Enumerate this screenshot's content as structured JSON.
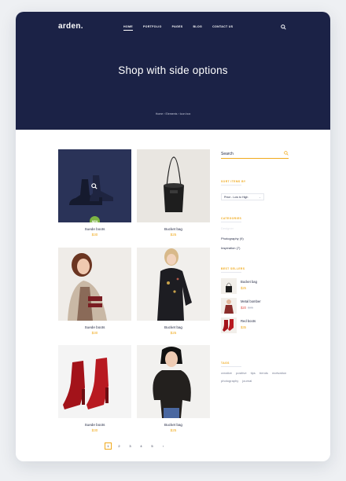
{
  "header": {
    "logo": "arden.",
    "nav": [
      "HOME",
      "PORTFOLIO",
      "PAGES",
      "BLOG",
      "CONTACT US"
    ],
    "active_nav": "HOME",
    "title": "Shop with side options",
    "breadcrumb": "Home › Elements › Icon box"
  },
  "products": [
    {
      "name": "Suede boots",
      "price": "$30",
      "badge": "NEW"
    },
    {
      "name": "Bucket bag",
      "price": "$25"
    },
    {
      "name": "Suede boots",
      "price": "$30"
    },
    {
      "name": "Bucket bag",
      "price": "$25"
    },
    {
      "name": "Suede boots",
      "price": "$30"
    },
    {
      "name": "Bucket bag",
      "price": "$25"
    }
  ],
  "pagination": [
    "1",
    "2",
    "3",
    "4",
    "5",
    "›"
  ],
  "sidebar": {
    "search_placeholder": "Search",
    "sort_title": "SORT ITEMS BY",
    "sort_value": "Price - Low to High",
    "categories_title": "CATEGORIES",
    "categories": [
      {
        "label": "Designer",
        "dim": true
      },
      {
        "label": "Photography (9)",
        "dim": false
      },
      {
        "label": "Inspiration (7)",
        "dim": false
      }
    ],
    "bestsellers_title": "BEST SELLERS",
    "bestsellers": [
      {
        "name": "Bucket bag",
        "price": "$25"
      },
      {
        "name": "Metal bomber",
        "price": "$20",
        "old_price": "$35"
      },
      {
        "name": "Red boots",
        "price": "$35"
      }
    ],
    "tags_title": "TAGS",
    "tags": [
      "creative",
      "positive",
      "tips",
      "trends",
      "motivation",
      "photography",
      "journal"
    ]
  },
  "colors": {
    "navy": "#1b2246",
    "accent": "#f0a91b",
    "badge": "#7cb342",
    "sale": "#e0534a"
  }
}
